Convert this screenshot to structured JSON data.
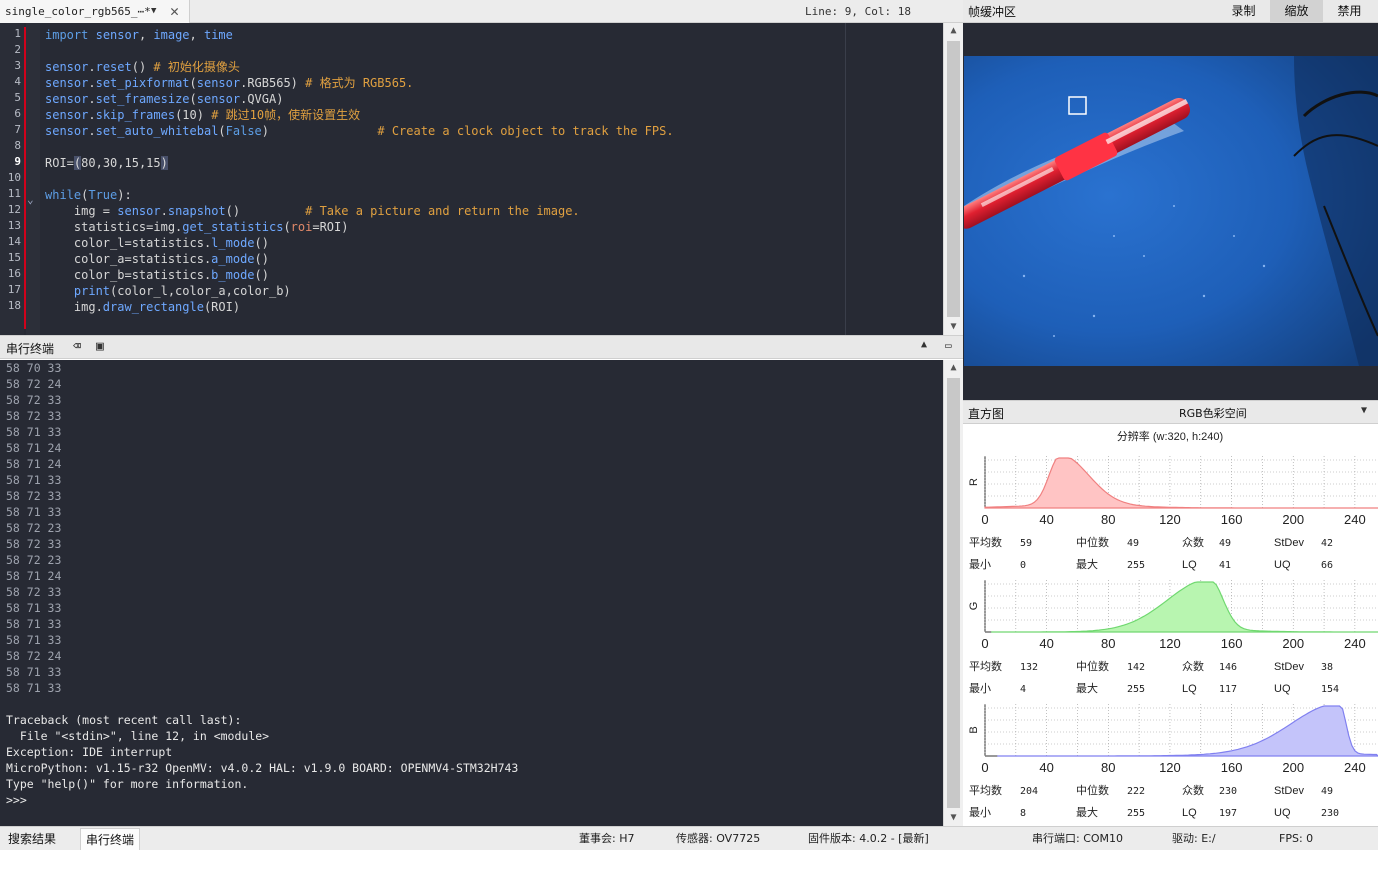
{
  "editor": {
    "tab_label": "single_color_rgb565_⋯*",
    "position": "Line: 9, Col: 18",
    "line_numbers": [
      "1",
      "2",
      "3",
      "4",
      "5",
      "6",
      "7",
      "8",
      "9",
      "10",
      "11",
      "12",
      "13",
      "14",
      "15",
      "16",
      "17",
      "18"
    ],
    "code_lines": [
      "import sensor, image, time",
      "",
      "sensor.reset() # 初始化摄像头",
      "sensor.set_pixformat(sensor.RGB565) # 格式为 RGB565.",
      "sensor.set_framesize(sensor.QVGA)",
      "sensor.skip_frames(10) # 跳过10帧，使新设置生效",
      "sensor.set_auto_whitebal(False)               # Create a clock object to track the FPS.",
      "",
      "ROI=(80,30,15,15)",
      "",
      "while(True):",
      "    img = sensor.snapshot()         # Take a picture and return the image.",
      "    statistics=img.get_statistics(roi=ROI)",
      "    color_l=statistics.l_mode()",
      "    color_a=statistics.a_mode()",
      "    color_b=statistics.b_mode()",
      "    print(color_l,color_a,color_b)",
      "    img.draw_rectangle(ROI)"
    ]
  },
  "serial": {
    "title": "串行终端",
    "output_lines": [
      "58 70 33",
      "58 72 24",
      "58 72 33",
      "58 72 33",
      "58 71 33",
      "58 71 24",
      "58 71 24",
      "58 71 33",
      "58 72 33",
      "58 71 33",
      "58 72 23",
      "58 72 33",
      "58 72 23",
      "58 71 24",
      "58 72 33",
      "58 71 33",
      "58 71 33",
      "58 71 33",
      "58 72 24",
      "58 71 33",
      "58 71 33"
    ],
    "traceback_lines": [
      "Traceback (most recent call last):",
      "  File \"<stdin>\", line 12, in <module>",
      "Exception: IDE interrupt",
      "MicroPython: v1.15-r32 OpenMV: v4.0.2 HAL: v1.9.0 BOARD: OPENMV4-STM32H743",
      "Type \"help()\" for more information.",
      ">>>"
    ]
  },
  "framebuffer": {
    "title": "帧缓冲区",
    "buttons": [
      "录制",
      "缩放",
      "禁用"
    ]
  },
  "histogram": {
    "title": "直方图",
    "color_space": "RGB色彩空间",
    "resolution": "分辨率 (w:320, h:240)",
    "ticks": [
      "0",
      "40",
      "80",
      "120",
      "160",
      "200",
      "240"
    ],
    "channels": [
      {
        "axis": "R",
        "color": "#f08080",
        "fill": "#ffc4c4",
        "peak": 40,
        "stats": {
          "mean_label": "平均数",
          "mean": "59",
          "median_label": "中位数",
          "median": "49",
          "mode_label": "众数",
          "mode": "49",
          "stdev_label": "StDev",
          "stdev": "42",
          "min_label": "最小",
          "min": "0",
          "max_label": "最大",
          "max": "255",
          "lq_label": "LQ",
          "lq": "41",
          "uq_label": "UQ",
          "uq": "66"
        }
      },
      {
        "axis": "G",
        "color": "#70d870",
        "fill": "#b8f5b0",
        "peak": 146,
        "stats": {
          "mean_label": "平均数",
          "mean": "132",
          "median_label": "中位数",
          "median": "142",
          "mode_label": "众数",
          "mode": "146",
          "stdev_label": "StDev",
          "stdev": "38",
          "min_label": "最小",
          "min": "4",
          "max_label": "最大",
          "max": "255",
          "lq_label": "LQ",
          "lq": "117",
          "uq_label": "UQ",
          "uq": "154"
        }
      },
      {
        "axis": "B",
        "color": "#8080f0",
        "fill": "#c4c4fa",
        "peak": 230,
        "stats": {
          "mean_label": "平均数",
          "mean": "204",
          "median_label": "中位数",
          "median": "222",
          "mode_label": "众数",
          "mode": "230",
          "stdev_label": "StDev",
          "stdev": "49",
          "min_label": "最小",
          "min": "8",
          "max_label": "最大",
          "max": "255",
          "lq_label": "LQ",
          "lq": "197",
          "uq_label": "UQ",
          "uq": "230"
        }
      }
    ]
  },
  "status": {
    "tabs": [
      "搜索结果",
      "串行终端"
    ],
    "board": "董事会: H7",
    "sensor": "传感器: OV7725",
    "firmware": "固件版本: 4.0.2 - [最新]",
    "port": "串行端口: COM10",
    "drive": "驱动: E:/",
    "fps": "FPS: 0"
  }
}
